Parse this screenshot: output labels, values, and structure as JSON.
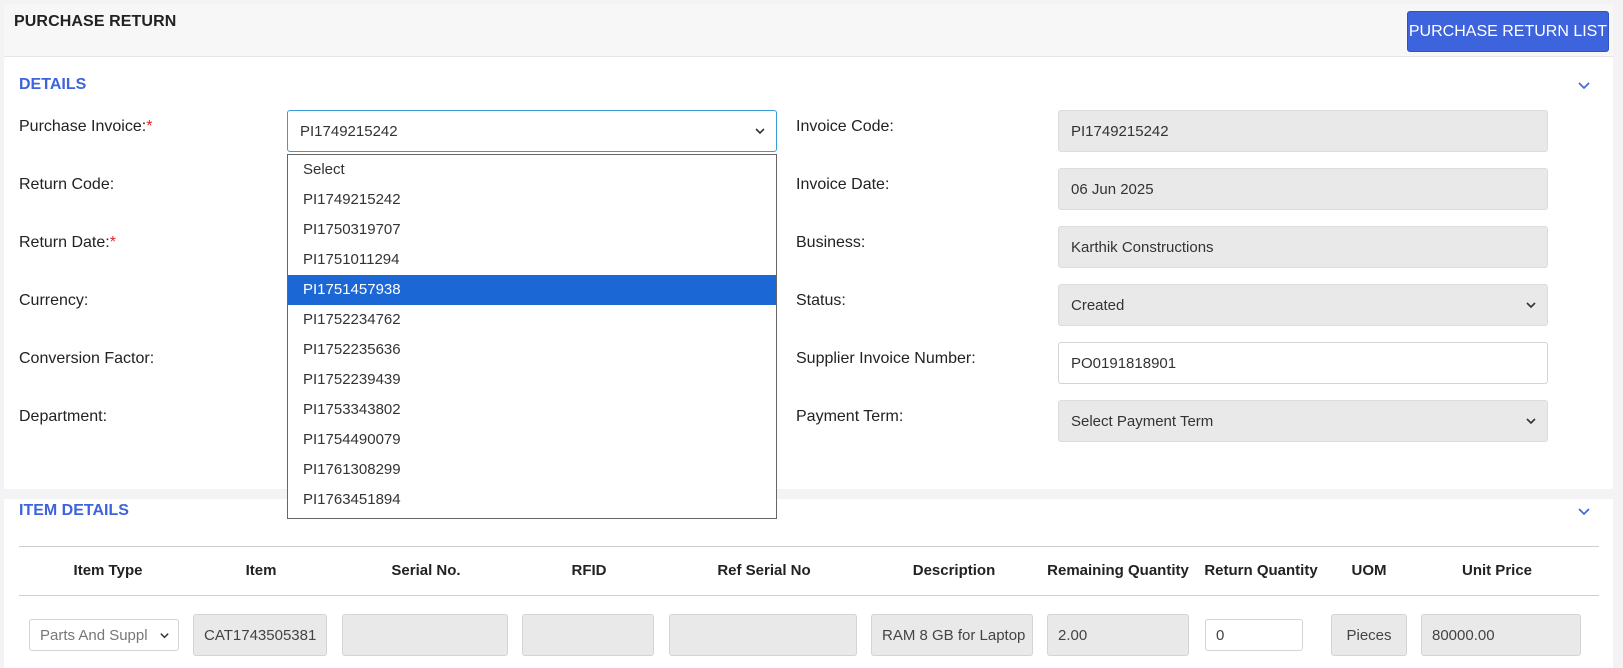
{
  "header": {
    "title": "PURCHASE RETURN",
    "list_button": "PURCHASE RETURN LIST"
  },
  "details": {
    "title": "DETAILS",
    "left": [
      {
        "label": "Purchase Invoice:",
        "required": "*",
        "value": "PI1749215242"
      },
      {
        "label": "Return Code:"
      },
      {
        "label": "Return Date:",
        "required": "*"
      },
      {
        "label": "Currency:"
      },
      {
        "label": "Conversion Factor:"
      },
      {
        "label": "Department:"
      }
    ],
    "right": [
      {
        "label": "Invoice Code:",
        "value": "PI1749215242"
      },
      {
        "label": "Invoice Date:",
        "value": "06 Jun 2025"
      },
      {
        "label": "Business:",
        "value": "Karthik Constructions"
      },
      {
        "label": "Status:",
        "value": "Created"
      },
      {
        "label": "Supplier Invoice Number:",
        "value": "PO0191818901"
      },
      {
        "label": "Payment Term:",
        "value": "Select Payment Term"
      }
    ],
    "invoice_options": [
      "Select",
      "PI1749215242",
      "PI1750319707",
      "PI1751011294",
      "PI1751457938",
      "PI1752234762",
      "PI1752235636",
      "PI1752239439",
      "PI1753343802",
      "PI1754490079",
      "PI1761308299",
      "PI1763451894"
    ],
    "highlighted_option": "PI1751457938"
  },
  "items": {
    "title": "ITEM DETAILS",
    "columns": [
      "Item Type",
      "Item",
      "Serial No.",
      "RFID",
      "Ref Serial No",
      "Description",
      "Remaining Quantity",
      "Return Quantity",
      "UOM",
      "Unit Price"
    ],
    "row": {
      "item_type": "Parts And Suppl",
      "item": "CAT1743505381",
      "serial_no": "",
      "rfid": "",
      "ref_serial_no": "",
      "description": "RAM 8 GB for Laptop",
      "remaining_quantity": "2.00",
      "return_quantity": "0",
      "uom": "Pieces",
      "unit_price": "80000.00"
    }
  },
  "colors": {
    "accent": "#3d63dd",
    "required": "#e02424",
    "highlight": "#1b67d6",
    "readonly_bg": "#e9e9ea"
  }
}
